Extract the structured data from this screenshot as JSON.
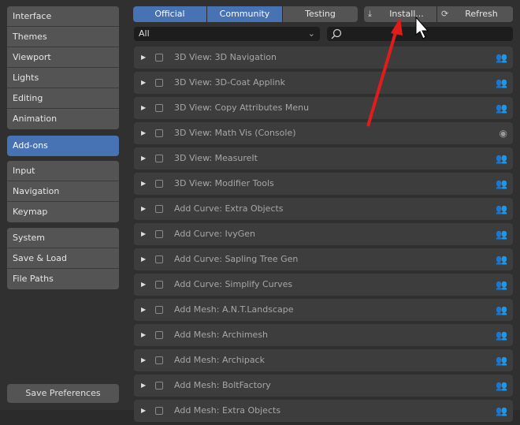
{
  "sidebar": {
    "groups": [
      [
        "Interface",
        "Themes",
        "Viewport",
        "Lights",
        "Editing",
        "Animation"
      ],
      [
        "Add-ons"
      ],
      [
        "Input",
        "Navigation",
        "Keymap"
      ],
      [
        "System",
        "Save & Load",
        "File Paths"
      ]
    ],
    "save_label": "Save Preferences"
  },
  "toolbar": {
    "tabs": [
      "Official",
      "Community",
      "Testing"
    ],
    "install": "Install...",
    "refresh": "Refresh"
  },
  "filter": {
    "category": "All",
    "search_placeholder": ""
  },
  "addons": [
    {
      "name": "3D View: 3D Navigation",
      "icon": "community"
    },
    {
      "name": "3D View: 3D-Coat Applink",
      "icon": "community"
    },
    {
      "name": "3D View: Copy Attributes Menu",
      "icon": "community"
    },
    {
      "name": "3D View: Math Vis (Console)",
      "icon": "blender"
    },
    {
      "name": "3D View: MeasureIt",
      "icon": "community"
    },
    {
      "name": "3D View: Modifier Tools",
      "icon": "community"
    },
    {
      "name": "Add Curve: Extra Objects",
      "icon": "community"
    },
    {
      "name": "Add Curve: IvyGen",
      "icon": "community"
    },
    {
      "name": "Add Curve: Sapling Tree Gen",
      "icon": "community"
    },
    {
      "name": "Add Curve: Simplify Curves",
      "icon": "community"
    },
    {
      "name": "Add Mesh: A.N.T.Landscape",
      "icon": "community"
    },
    {
      "name": "Add Mesh: Archimesh",
      "icon": "community"
    },
    {
      "name": "Add Mesh: Archipack",
      "icon": "community"
    },
    {
      "name": "Add Mesh: BoltFactory",
      "icon": "community"
    },
    {
      "name": "Add Mesh: Extra Objects",
      "icon": "community"
    }
  ]
}
